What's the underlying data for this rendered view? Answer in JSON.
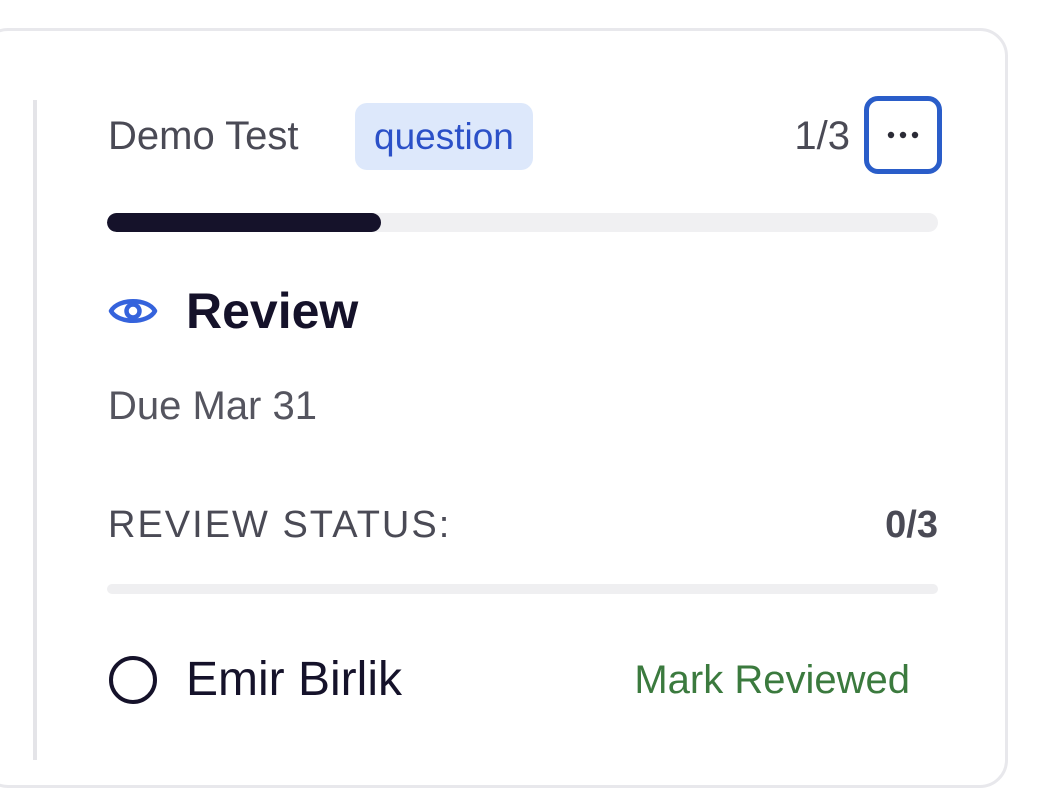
{
  "header": {
    "title": "Demo Test",
    "tag": "question",
    "counter": "1/3",
    "more_icon": "more-horizontal-icon"
  },
  "progress": {
    "fraction": 0.33
  },
  "section": {
    "icon": "eye-icon",
    "title": "Review",
    "due": "Due Mar 31"
  },
  "review_status": {
    "label": "REVIEW STATUS:",
    "count": "0/3",
    "fraction": 0
  },
  "reviewers": [
    {
      "name": "Emir Birlik",
      "action": "Mark Reviewed",
      "reviewed": false
    }
  ],
  "colors": {
    "accent_blue": "#2a5dc9",
    "tag_bg": "#dde8fb",
    "progress_fill": "#15122a",
    "action_green": "#3b7a3e"
  }
}
